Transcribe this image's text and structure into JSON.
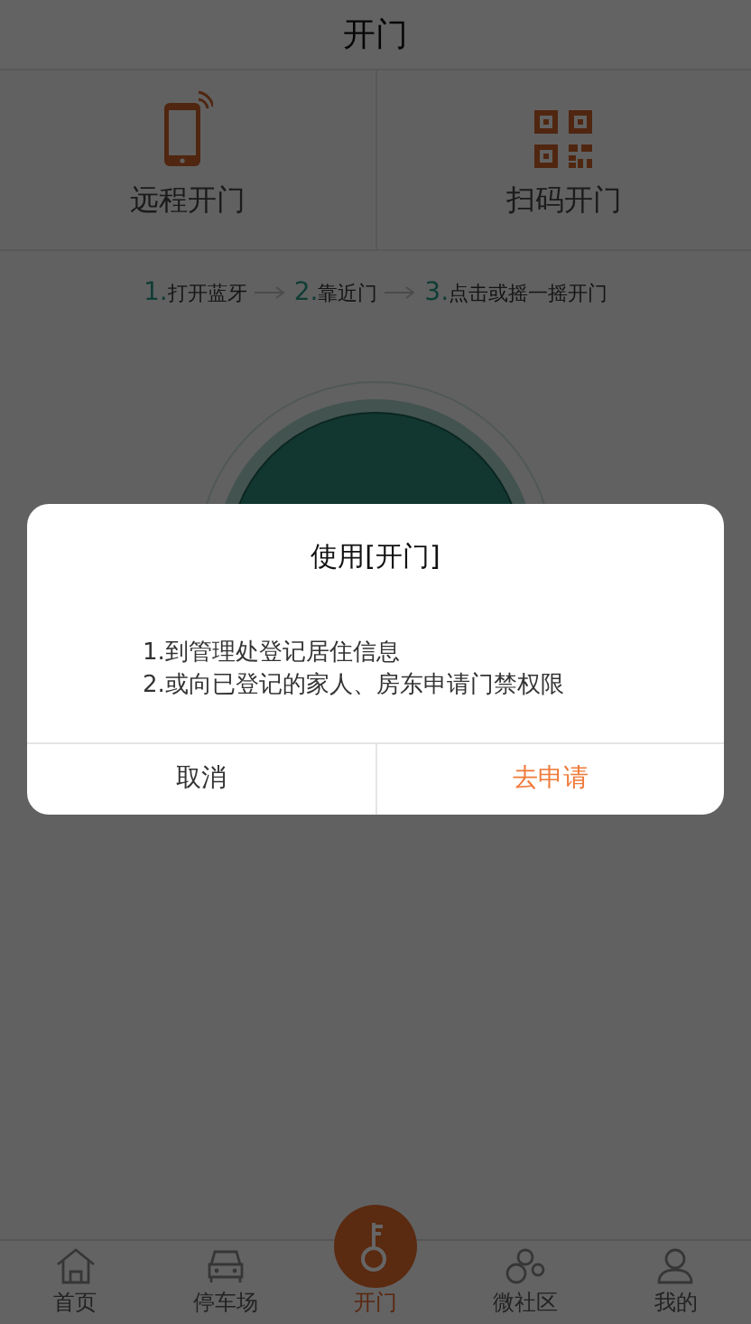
{
  "header": {
    "title": "开门"
  },
  "modes": [
    {
      "kind": "phone",
      "label": "远程开门"
    },
    {
      "kind": "qr",
      "label": "扫码开门"
    }
  ],
  "steps": [
    {
      "number": "1.",
      "text": "打开蓝牙"
    },
    {
      "number": "2.",
      "text": "靠近门"
    },
    {
      "number": "3.",
      "text": "点击或摇一摇开门"
    }
  ],
  "dialog": {
    "title": "使用[开门]",
    "lines": [
      "1.到管理处登记居住信息",
      "2.或向已登记的家人、房东申请门禁权限"
    ],
    "buttons": [
      {
        "label": "取消",
        "kind": "cancel"
      },
      {
        "label": "去申请",
        "kind": "primary"
      }
    ]
  },
  "tabs": [
    {
      "kind": "home",
      "label": "首页",
      "selected": false
    },
    {
      "kind": "car",
      "label": "停车场",
      "selected": false
    },
    {
      "kind": "key",
      "label": "开门",
      "selected": true
    },
    {
      "kind": "community",
      "label": "微社区",
      "selected": false
    },
    {
      "kind": "user",
      "label": "我的",
      "selected": false
    }
  ]
}
